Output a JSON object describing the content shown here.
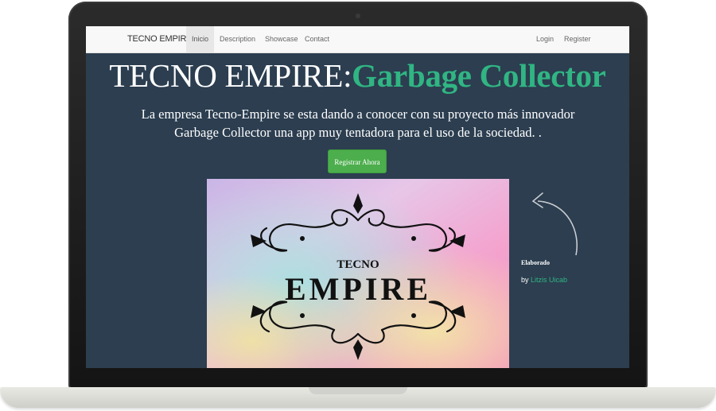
{
  "navbar": {
    "brand": "TECNO EMPIRE",
    "links": [
      "Inicio",
      "Description",
      "Showcase",
      "Contact"
    ],
    "active": "Inicio",
    "right_links": [
      "Login",
      "Register"
    ]
  },
  "hero": {
    "title_main": "TECNO EMPIRE:",
    "title_accent": "Garbage Collector",
    "description": "La empresa Tecno-Empire se esta dando a conocer con su proyecto más innovador Garbage Collector una app muy tentadora para el uso de la sociedad. .",
    "button_label": "Registrar Ahora"
  },
  "promo_image": {
    "text_top": "TECNO",
    "text_main": "EMPIRE"
  },
  "credit": {
    "title": "Elaborado",
    "by_prefix": "by",
    "author": "Litzis Uicab"
  },
  "colors": {
    "accent": "#30b583",
    "background": "#2c3e50",
    "button": "#4cae4c"
  }
}
